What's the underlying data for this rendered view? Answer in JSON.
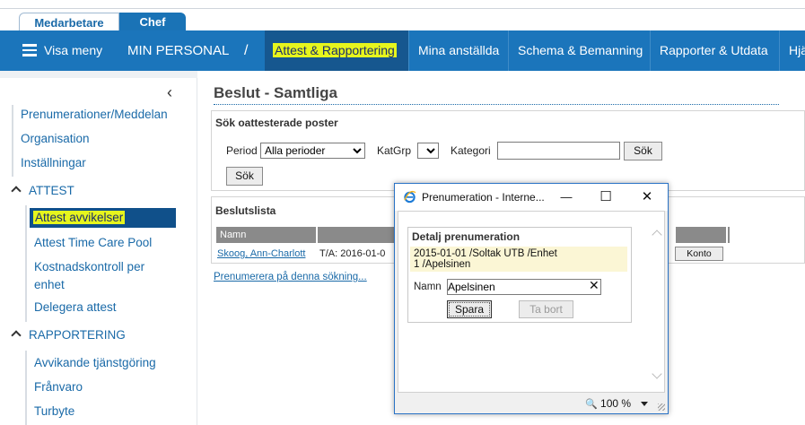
{
  "roles": {
    "tabs": [
      {
        "label": "Medarbetare"
      },
      {
        "label": "Chef"
      }
    ]
  },
  "nav": {
    "menu_label": "Visa meny",
    "section": "MIN PERSONAL",
    "separator": "/",
    "items": [
      {
        "label": "Attest & Rapportering"
      },
      {
        "label": "Mina anställda"
      },
      {
        "label": "Schema & Bemanning"
      },
      {
        "label": "Rapporter & Utdata"
      },
      {
        "label": "Hjä"
      }
    ]
  },
  "sidebar": {
    "top_links": [
      {
        "label": "Prenumerationer/Meddelan"
      },
      {
        "label": "Organisation"
      },
      {
        "label": "Inställningar"
      }
    ],
    "groups": [
      {
        "title": "ATTEST",
        "items": [
          {
            "label": "Attest avvikelser"
          },
          {
            "label": "Attest Time Care Pool"
          },
          {
            "label": "Kostnadskontroll per"
          },
          {
            "label": "enhet"
          },
          {
            "label": "Delegera attest"
          }
        ]
      },
      {
        "title": "RAPPORTERING",
        "items": [
          {
            "label": "Avvikande tjänstgöring"
          },
          {
            "label": "Frånvaro"
          },
          {
            "label": "Turbyte"
          }
        ]
      }
    ]
  },
  "main": {
    "title": "Beslut - Samtliga",
    "search": {
      "title": "Sök oattesterade poster",
      "period_label": "Period",
      "period_value": "Alla perioder",
      "katgrp_label": "KatGrp",
      "kategori_label": "Kategori",
      "kategori_value": "",
      "search_btn": "Sök",
      "search_btn2": "Sök"
    },
    "list": {
      "title": "Beslutslista",
      "columns": [
        "Namn",
        "",
        ""
      ],
      "row": {
        "name": "Skoog, Ann-Charlott",
        "text": "T/A: 2016-01-0",
        "konto": "Konto"
      }
    },
    "subscribe_link": "Prenumerera på denna sökning..."
  },
  "dialog": {
    "title": "Prenumeration - Interne...",
    "window_controls": {
      "minimize": "—",
      "maximize": "☐",
      "close": "✕"
    },
    "section_title": "Detalj prenumeration",
    "period_line1": "2015-01-01 /Soltak UTB /Enhet",
    "period_line2": "1 /Apelsinen",
    "name_label": "Namn",
    "name_value": "Apelsinen",
    "save_btn": "Spara",
    "delete_btn": "Ta bort",
    "zoom": "100 %"
  }
}
